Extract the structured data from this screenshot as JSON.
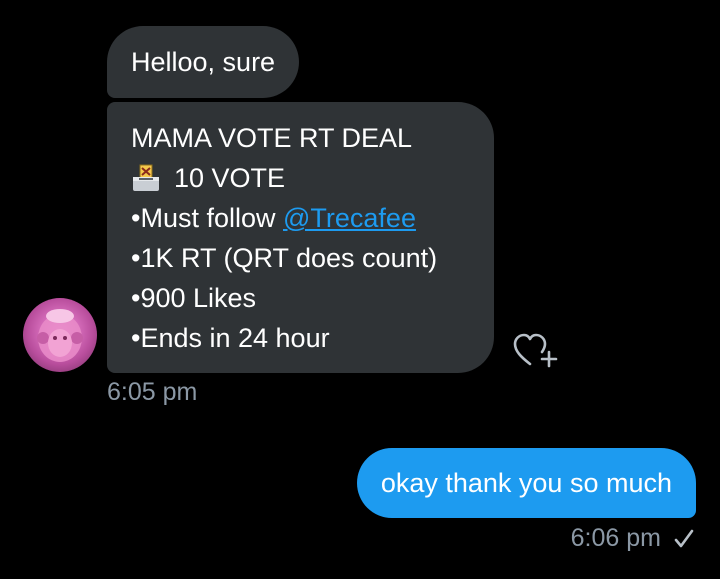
{
  "colors": {
    "background": "#000000",
    "incoming_bubble": "#2f3336",
    "outgoing_bubble": "#1d9bf0",
    "timestamp": "#8b98a5",
    "link": "#1d9bf0"
  },
  "messages": {
    "incoming": {
      "greeting": "Helloo, sure",
      "deal": {
        "title": "MAMA VOTE RT DEAL",
        "ballot_icon": "ballot-box-with-ballot-icon",
        "vote": "10 VOTE",
        "follow_prefix": "•Must follow ",
        "follow_mention": "@Trecafee",
        "rt": "•1K RT (QRT does count)",
        "likes": "•900 Likes",
        "ends": "•Ends in 24 hour"
      },
      "react_icon": "heart-plus-icon",
      "timestamp": "6:05 pm"
    },
    "outgoing": {
      "text": "okay thank you so much",
      "timestamp": "6:06 pm",
      "status_icon": "check-icon"
    }
  }
}
